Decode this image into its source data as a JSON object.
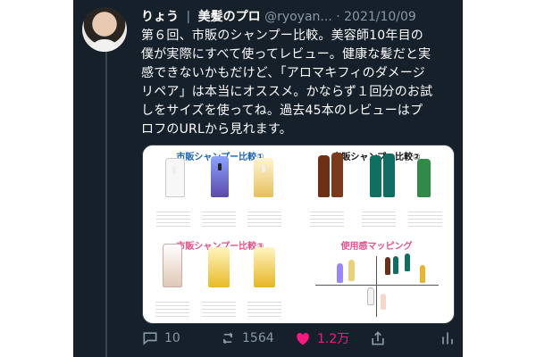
{
  "tweet": {
    "user_name": "りょう",
    "separator": "|",
    "profile_tag": "美髪のプロ",
    "handle": "@ryoyan...",
    "dot": "·",
    "date": "2021/10/09",
    "text": "第６回、市販のシャンプー比較。美容師10年目の\n僕が実際にすべて使ってレビュー。健康な髪だと実\n感できないかもだけど、「アロマキフィのダメージ\nリペア」は本当にオススメ。かならず１回分のお試\nしをサイズを使ってね。過去45本のレビューはプ\nロフのURLから見れます。"
  },
  "images": {
    "panel1_title": "市販シャンプー比較①",
    "panel2_title": "市販シャンプー比較②",
    "panel3_title": "市販シャンプー比較③",
    "panel4_title": "使用感マッピング"
  },
  "actions": {
    "reply_count": "10",
    "retweet_count": "1564",
    "like_count": "1.2万"
  },
  "icons": {
    "reply": "comment-icon",
    "retweet": "retweet-icon",
    "like": "heart-icon",
    "share": "share-icon",
    "stats": "analytics-icon"
  },
  "colors": {
    "background": "#15202b",
    "like": "#f91880",
    "secondary_text": "#8899a6"
  }
}
